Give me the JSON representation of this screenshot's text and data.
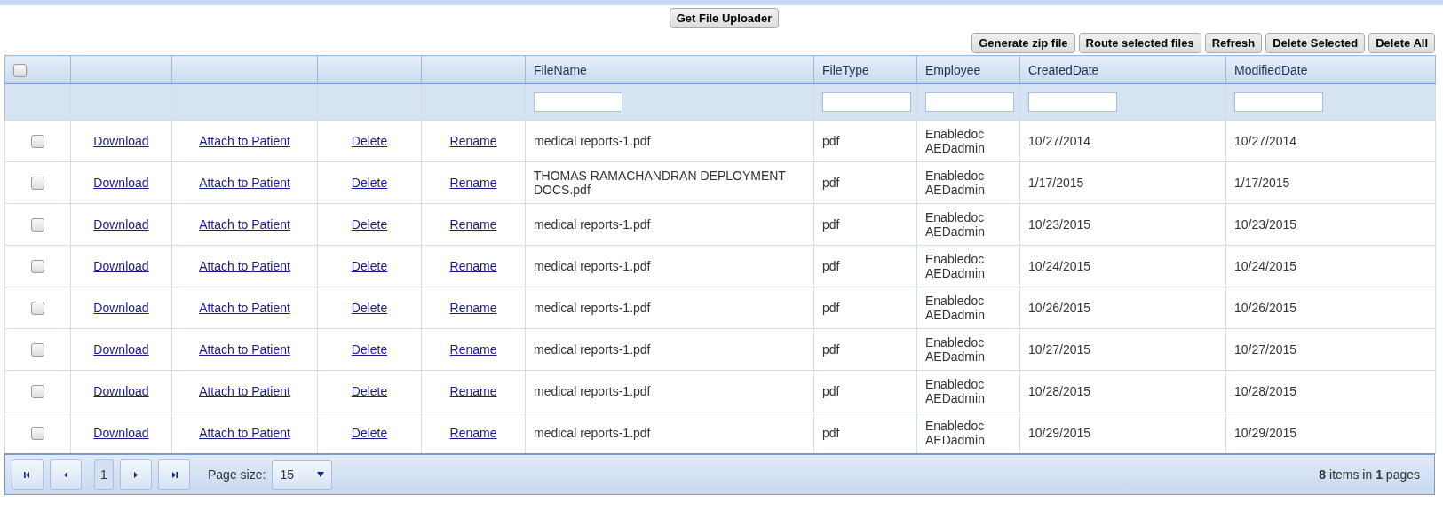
{
  "toolbar": {
    "uploader_button": "Get File Uploader",
    "actions": [
      "Generate zip file",
      "Route selected files",
      "Refresh",
      "Delete Selected",
      "Delete All"
    ]
  },
  "table": {
    "select_all": {
      "checked": false
    },
    "columns": [
      {
        "kind": "check"
      },
      {
        "kind": "link"
      },
      {
        "kind": "link"
      },
      {
        "kind": "link"
      },
      {
        "kind": "link"
      },
      {
        "kind": "text",
        "label": "FileName",
        "filterable": true
      },
      {
        "kind": "text",
        "label": "FileType",
        "filterable": true
      },
      {
        "kind": "text",
        "label": "Employee",
        "filterable": true
      },
      {
        "kind": "text",
        "label": "CreatedDate",
        "filterable": true
      },
      {
        "kind": "text",
        "label": "ModifiedDate",
        "filterable": true
      }
    ],
    "rows": [
      {
        "checked": false,
        "links": [
          "Download",
          "Attach to Patient",
          "Delete",
          "Rename"
        ],
        "cells": [
          "medical reports-1.pdf",
          "pdf",
          "Enabledoc AEDadmin",
          "10/27/2014",
          "10/27/2014"
        ]
      },
      {
        "checked": false,
        "links": [
          "Download",
          "Attach to Patient",
          "Delete",
          "Rename"
        ],
        "cells": [
          "THOMAS RAMACHANDRAN DEPLOYMENT DOCS.pdf",
          "pdf",
          "Enabledoc AEDadmin",
          "1/17/2015",
          "1/17/2015"
        ]
      },
      {
        "checked": false,
        "links": [
          "Download",
          "Attach to Patient",
          "Delete",
          "Rename"
        ],
        "cells": [
          "medical reports-1.pdf",
          "pdf",
          "Enabledoc AEDadmin",
          "10/23/2015",
          "10/23/2015"
        ]
      },
      {
        "checked": false,
        "links": [
          "Download",
          "Attach to Patient",
          "Delete",
          "Rename"
        ],
        "cells": [
          "medical reports-1.pdf",
          "pdf",
          "Enabledoc AEDadmin",
          "10/24/2015",
          "10/24/2015"
        ]
      },
      {
        "checked": false,
        "links": [
          "Download",
          "Attach to Patient",
          "Delete",
          "Rename"
        ],
        "cells": [
          "medical reports-1.pdf",
          "pdf",
          "Enabledoc AEDadmin",
          "10/26/2015",
          "10/26/2015"
        ]
      },
      {
        "checked": false,
        "links": [
          "Download",
          "Attach to Patient",
          "Delete",
          "Rename"
        ],
        "cells": [
          "medical reports-1.pdf",
          "pdf",
          "Enabledoc AEDadmin",
          "10/27/2015",
          "10/27/2015"
        ]
      },
      {
        "checked": false,
        "links": [
          "Download",
          "Attach to Patient",
          "Delete",
          "Rename"
        ],
        "cells": [
          "medical reports-1.pdf",
          "pdf",
          "Enabledoc AEDadmin",
          "10/28/2015",
          "10/28/2015"
        ]
      },
      {
        "checked": false,
        "links": [
          "Download",
          "Attach to Patient",
          "Delete",
          "Rename"
        ],
        "cells": [
          "medical reports-1.pdf",
          "pdf",
          "Enabledoc AEDadmin",
          "10/29/2015",
          "10/29/2015"
        ]
      }
    ]
  },
  "pager": {
    "current_page": "1",
    "page_size_label": "Page size:",
    "page_size": "15",
    "summary": "**8** items in **1** pages"
  }
}
